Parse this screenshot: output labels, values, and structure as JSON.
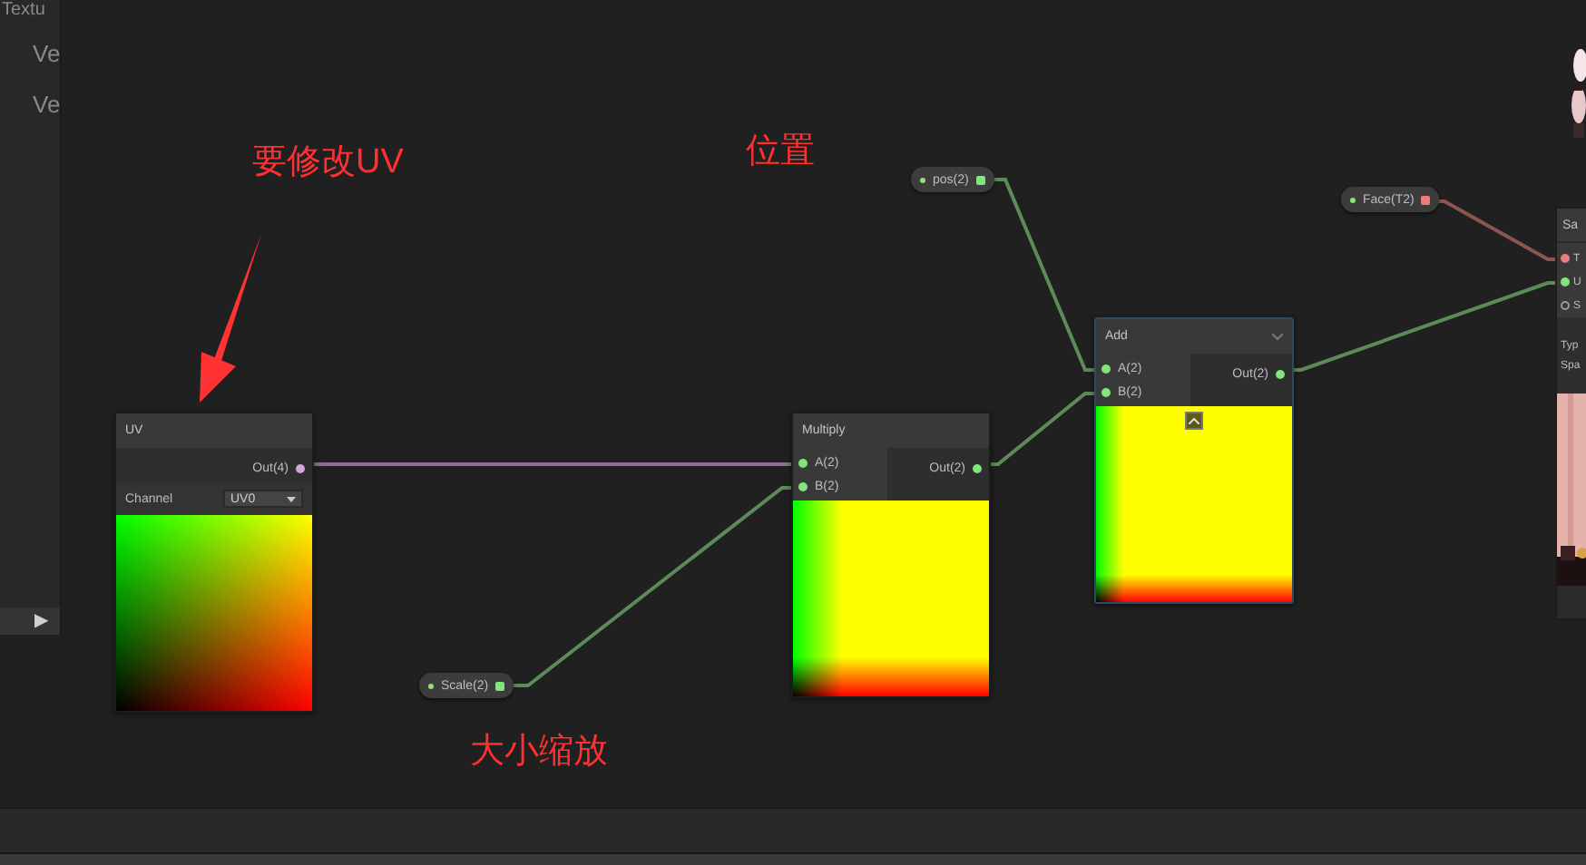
{
  "side_panel": {
    "items": [
      "Textu",
      "Ve",
      "Ve"
    ],
    "expand_button": "▶"
  },
  "annotations": [
    {
      "text": "要修改UV",
      "kind": "arrow"
    },
    {
      "text": "位置",
      "kind": "plain"
    },
    {
      "text": "大小缩放",
      "kind": "plain"
    }
  ],
  "nodes": [
    {
      "title": "UV",
      "selected": false,
      "kind": "uv",
      "outputs": [
        {
          "label": "Out(4)",
          "color": "#d0a6d8"
        }
      ],
      "controls": [
        {
          "label": "Channel",
          "value": "UV0"
        }
      ]
    },
    {
      "title": "Multiply",
      "selected": false,
      "kind": "multiply",
      "inputs": [
        {
          "label": "A(2)",
          "color": "#84e47c"
        },
        {
          "label": "B(2)",
          "color": "#84e47c"
        }
      ],
      "outputs": [
        {
          "label": "Out(2)",
          "color": "#84e47c"
        }
      ]
    },
    {
      "title": "Add",
      "selected": true,
      "kind": "add",
      "inputs": [
        {
          "label": "A(2)",
          "color": "#84e47c"
        },
        {
          "label": "B(2)",
          "color": "#84e47c"
        }
      ],
      "outputs": [
        {
          "label": "Out(2)",
          "color": "#84e47c"
        }
      ]
    }
  ],
  "properties": [
    {
      "label": "pos(2)",
      "color": "#84e47c"
    },
    {
      "label": "Scale(2)",
      "color": "#84e47c"
    },
    {
      "label": "Face(T2)",
      "color": "#f07a7a"
    }
  ],
  "partial_node": {
    "title": "Sa",
    "ports": [
      {
        "label": "T",
        "color": "#f07a7a",
        "connected": true
      },
      {
        "label": "U",
        "color": "#84e47c",
        "connected": true
      },
      {
        "label": "S",
        "color": "#9a9a9a",
        "connected": false
      }
    ],
    "fields": [
      "Typ",
      "Spa"
    ]
  }
}
